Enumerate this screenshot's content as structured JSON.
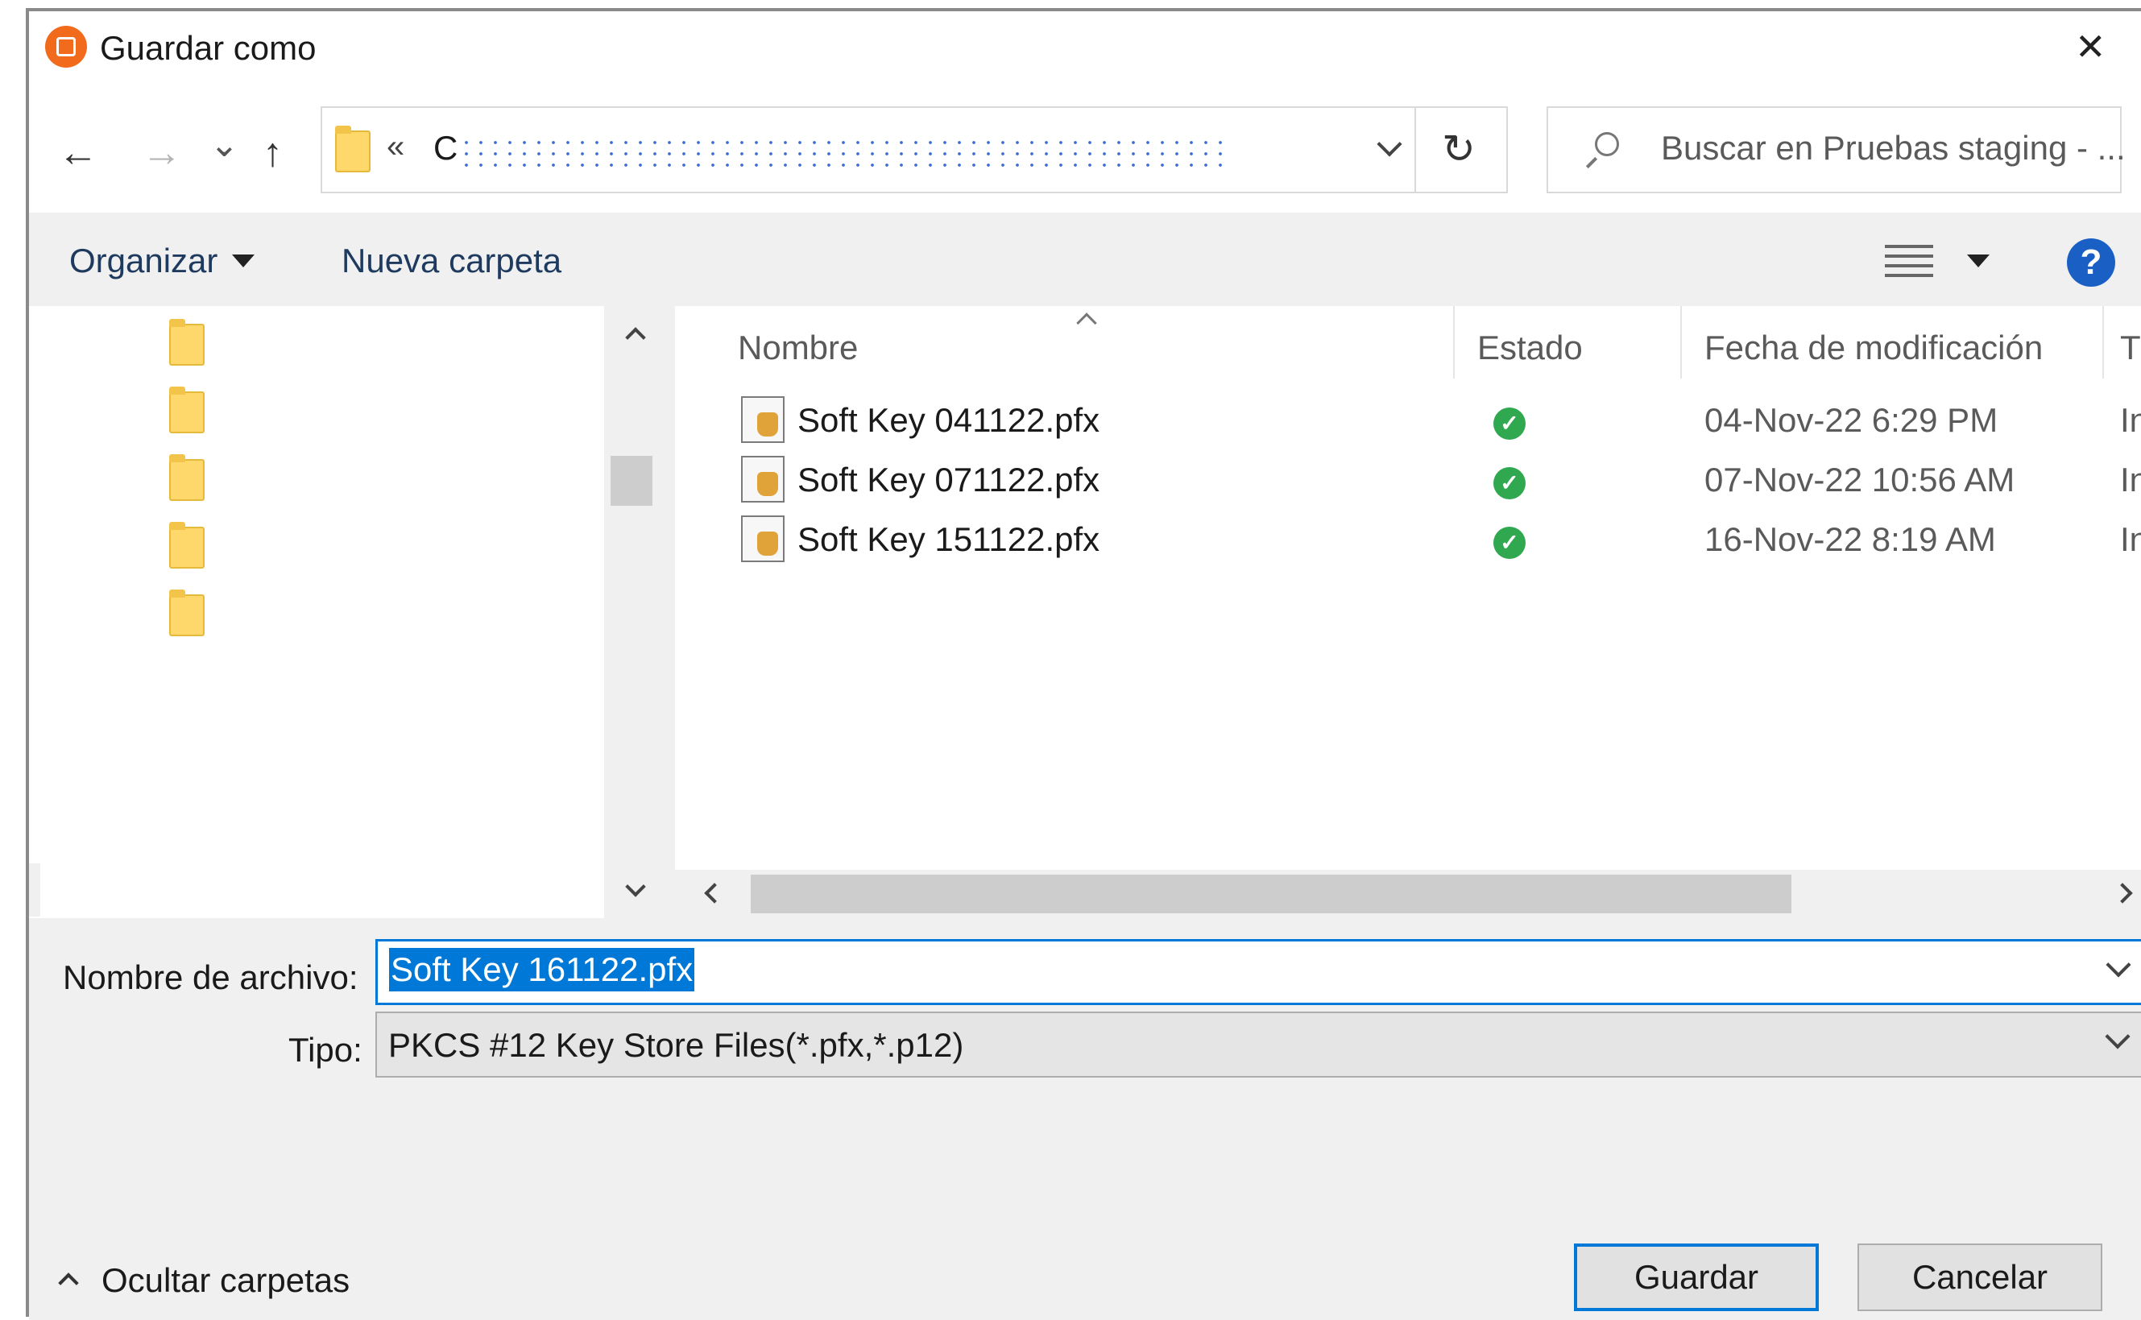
{
  "window": {
    "title": "Guardar como",
    "close_glyph": "✕"
  },
  "nav": {
    "back_glyph": "←",
    "forward_glyph": "→",
    "recent_glyph": "⌄",
    "up_glyph": "↑",
    "address_prefix": "«",
    "address_text": "C",
    "refresh_glyph": "↻",
    "search_placeholder": "Buscar en Pruebas staging - ..."
  },
  "toolbar": {
    "organize_label": "Organizar",
    "new_folder_label": "Nueva carpeta",
    "help_glyph": "?"
  },
  "tree": {
    "folder_count": 5
  },
  "columns": {
    "name": "Nombre",
    "status": "Estado",
    "modified": "Fecha de modificación",
    "type": "Tipo"
  },
  "files": [
    {
      "name": "Soft Key 041122.pfx",
      "modified": "04-Nov-22 6:29 PM",
      "type": "Inte"
    },
    {
      "name": "Soft Key 071122.pfx",
      "modified": "07-Nov-22 10:56 AM",
      "type": "Inte"
    },
    {
      "name": "Soft Key 151122.pfx",
      "modified": "16-Nov-22 8:19 AM",
      "type": "Inte"
    }
  ],
  "form": {
    "filename_label": "Nombre de archivo:",
    "filename_value": "Soft Key 161122.pfx",
    "type_label": "Tipo:",
    "type_value": "PKCS #12 Key Store Files(*.pfx,*.p12)"
  },
  "footer": {
    "hide_folders_label": "Ocultar carpetas",
    "save_label": "Guardar",
    "cancel_label": "Cancelar"
  },
  "colors": {
    "accent": "#0078d7",
    "selection": "#0078d7",
    "status_ok": "#2fa84f",
    "app_icon": "#f26b1d"
  }
}
